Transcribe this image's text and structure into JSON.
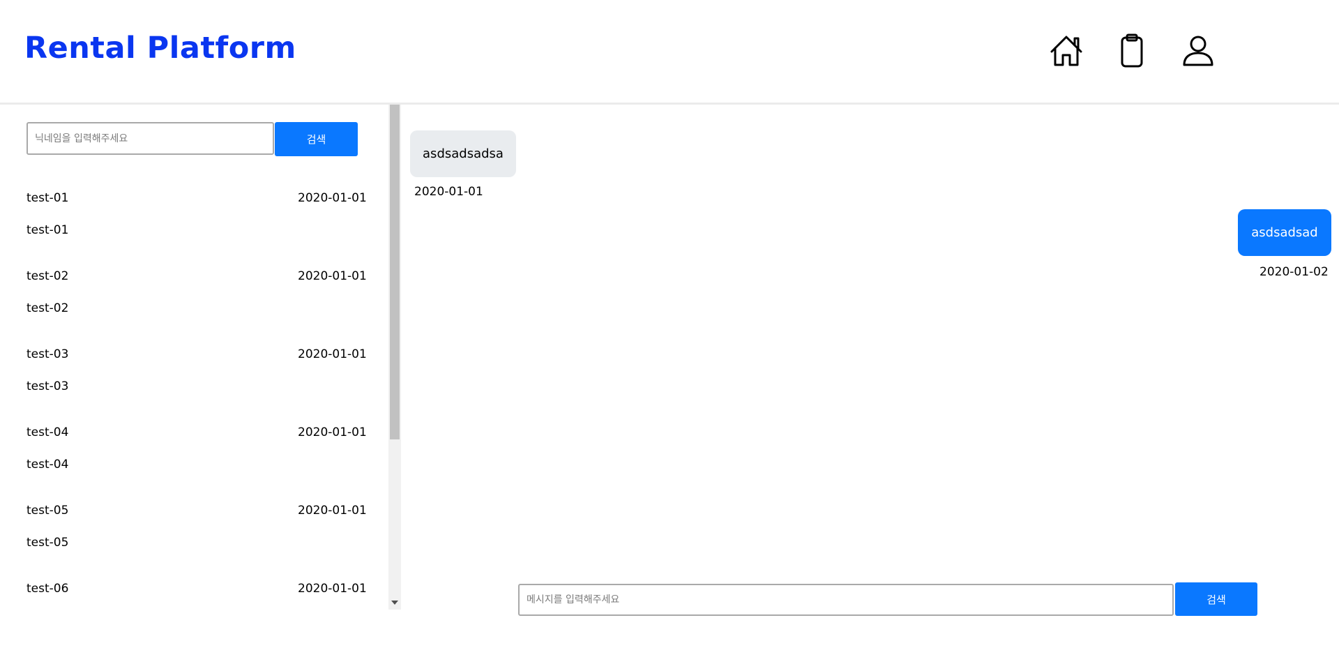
{
  "header": {
    "logo": "Rental Platform",
    "nav": [
      {
        "icon": "home-icon"
      },
      {
        "icon": "clipboard-icon"
      },
      {
        "icon": "user-icon"
      }
    ],
    "brand_color": "#0a36f0"
  },
  "sidebar": {
    "search": {
      "placeholder": "닉네임을 입력해주세요",
      "value": "",
      "button_label": "검색"
    },
    "chats": [
      {
        "name": "test-01",
        "date": "2020-01-01",
        "preview": "test-01"
      },
      {
        "name": "test-02",
        "date": "2020-01-01",
        "preview": "test-02"
      },
      {
        "name": "test-03",
        "date": "2020-01-01",
        "preview": "test-03"
      },
      {
        "name": "test-04",
        "date": "2020-01-01",
        "preview": "test-04"
      },
      {
        "name": "test-05",
        "date": "2020-01-01",
        "preview": "test-05"
      },
      {
        "name": "test-06",
        "date": "2020-01-01",
        "preview": ""
      }
    ]
  },
  "conversation": {
    "messages": [
      {
        "direction": "received",
        "text": "asdsadsadsa",
        "time": "2020-01-01"
      },
      {
        "direction": "sent",
        "text": "asdsadsad",
        "time": "2020-01-02"
      }
    ],
    "composer": {
      "placeholder": "메시지를 입력해주세요",
      "value": "",
      "button_label": "검색"
    }
  },
  "colors": {
    "accent": "#0a78ff",
    "received_bubble": "#e9ecef"
  }
}
